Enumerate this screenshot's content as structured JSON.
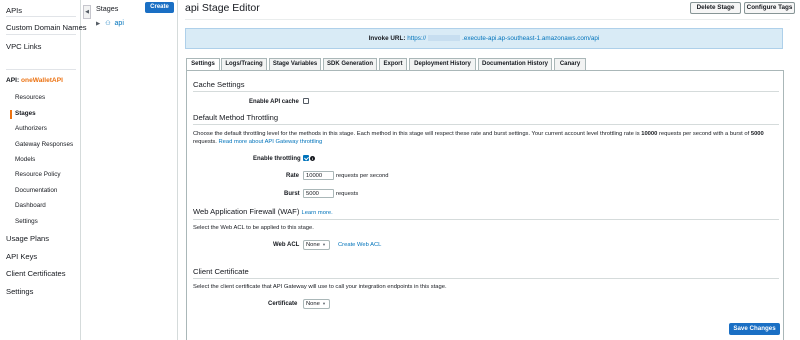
{
  "nav": {
    "apis": "APIs",
    "custom_domain_names": "Custom Domain Names",
    "vpc_links": "VPC Links",
    "api_prefix": "API:",
    "api_name": "oneWalletAPI",
    "sub_items": [
      "Resources",
      "Stages",
      "Authorizers",
      "Gateway Responses",
      "Models",
      "Resource Policy",
      "Documentation",
      "Dashboard",
      "Settings"
    ],
    "usage_plans": "Usage Plans",
    "api_keys": "API Keys",
    "client_certificates": "Client Certificates",
    "settings": "Settings"
  },
  "collapse_icon": "chevron-left-icon",
  "stages": {
    "title": "Stages",
    "create_label": "Create",
    "items": [
      {
        "name": "api"
      }
    ]
  },
  "header": {
    "title": "api Stage Editor",
    "delete_stage": "Delete Stage",
    "configure_tags": "Configure Tags"
  },
  "invoke": {
    "label": "Invoke URL:",
    "url_prefix": "https://",
    "url_suffix": ".execute-api.ap-southeast-1.amazonaws.com/api"
  },
  "tabs": [
    "Settings",
    "Logs/Tracing",
    "Stage Variables",
    "SDK Generation",
    "Export",
    "Deployment History",
    "Documentation History",
    "Canary"
  ],
  "active_tab": "Settings",
  "cache": {
    "heading": "Cache Settings",
    "enable_label": "Enable API cache",
    "enabled": false
  },
  "throttling": {
    "heading": "Default Method Throttling",
    "desc_part1": "Choose the default throttling level for the methods in this stage. Each method in this stage will respect these rate and burst settings. Your current account level throttling rate is",
    "account_rate": "10000",
    "desc_part2": "requests per second with a burst of",
    "account_burst": "5000",
    "desc_line2": "requests.",
    "read_more": "Read more about API Gateway throttling",
    "enable_label": "Enable throttling",
    "enabled": true,
    "rate_label": "Rate",
    "rate_value": "10000",
    "rate_suffix": "requests per second",
    "burst_label": "Burst",
    "burst_value": "5000",
    "burst_suffix": "requests"
  },
  "waf": {
    "heading": "Web Application Firewall (WAF)",
    "learn_more": "Learn more.",
    "desc": "Select the Web ACL to be applied to this stage.",
    "acl_label": "Web ACL",
    "acl_value": "None",
    "create_acl": "Create Web ACL"
  },
  "client_cert": {
    "heading": "Client Certificate",
    "desc": "Select the client certificate that API Gateway will use to call your integration endpoints in this stage.",
    "label": "Certificate",
    "value": "None"
  },
  "save_label": "Save Changes",
  "colors": {
    "accent": "#ec7211",
    "primary_button": "#1a6fc4",
    "link": "#0073bb",
    "invoke_bg": "#d9ebf6"
  }
}
